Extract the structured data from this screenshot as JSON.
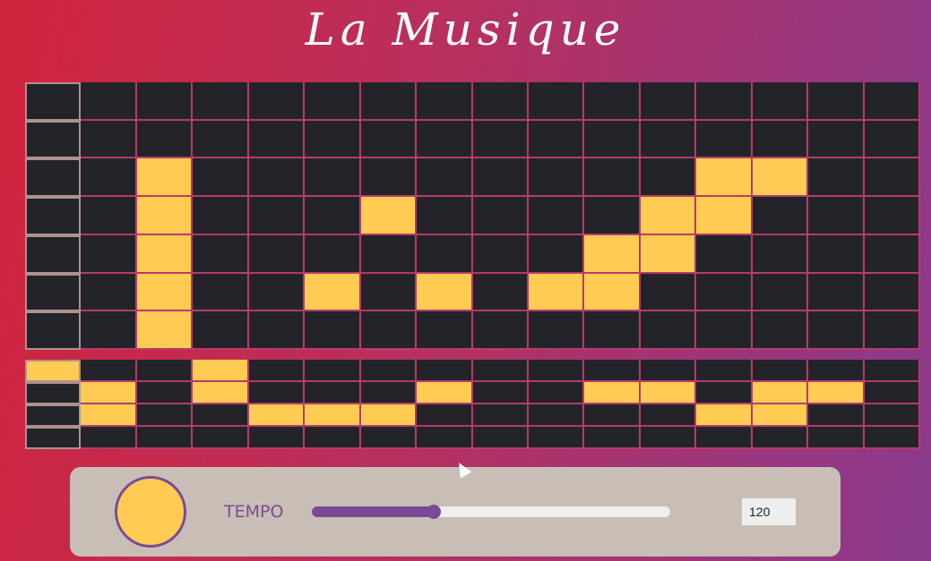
{
  "title": "La Musique",
  "melody_grid": {
    "rows": 7,
    "cols": 16,
    "active": [
      [],
      [],
      [
        2,
        12,
        13
      ],
      [
        2,
        6,
        11,
        12
      ],
      [
        2,
        10,
        11
      ],
      [
        2,
        5,
        7,
        9,
        10
      ],
      [
        2
      ]
    ]
  },
  "drum_grid": {
    "rows": 4,
    "cols": 16,
    "active": [
      [
        0,
        3
      ],
      [
        1,
        3,
        7,
        10,
        11,
        13,
        14
      ],
      [
        1,
        4,
        5,
        6,
        12,
        13
      ],
      []
    ]
  },
  "controls": {
    "tempo_label": "TEMPO",
    "tempo_value": "120",
    "slider_fraction": 0.34,
    "play_button_color": "#ffcb52",
    "accent_color": "#7b4a96"
  }
}
